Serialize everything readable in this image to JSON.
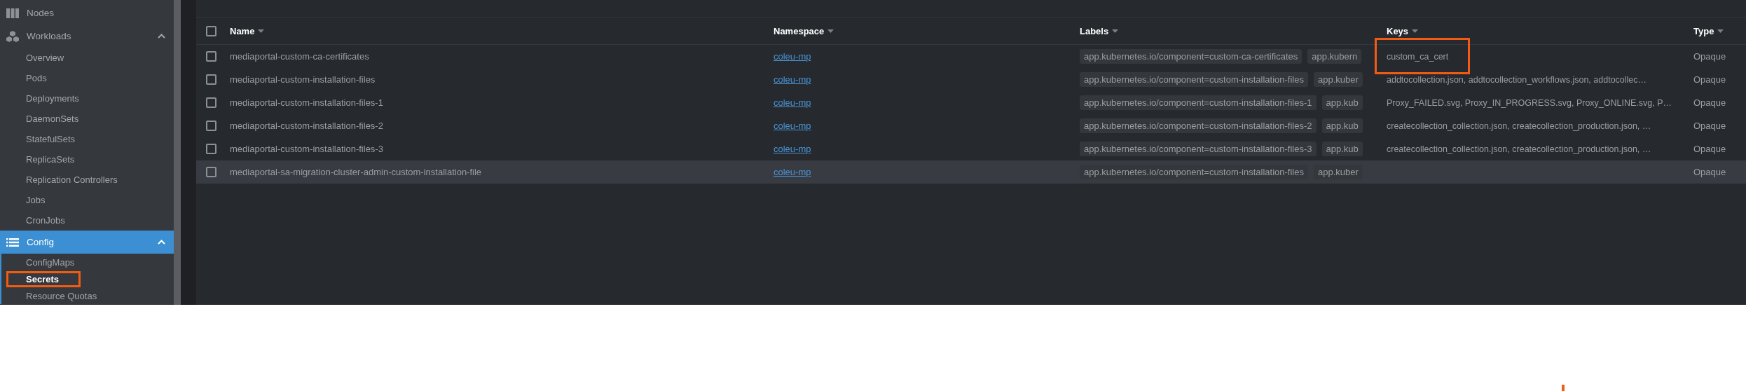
{
  "sidebar": {
    "items": [
      {
        "label": "Nodes",
        "selected": false
      },
      {
        "label": "Workloads",
        "selected": false,
        "expanded": true,
        "children": [
          {
            "label": "Overview",
            "selected": false,
            "annotated": false
          },
          {
            "label": "Pods",
            "selected": false,
            "annotated": false
          },
          {
            "label": "Deployments",
            "selected": false,
            "annotated": false
          },
          {
            "label": "DaemonSets",
            "selected": false,
            "annotated": false
          },
          {
            "label": "StatefulSets",
            "selected": false,
            "annotated": false
          },
          {
            "label": "ReplicaSets",
            "selected": false,
            "annotated": false
          },
          {
            "label": "Replication Controllers",
            "selected": false,
            "annotated": false
          },
          {
            "label": "Jobs",
            "selected": false,
            "annotated": false
          },
          {
            "label": "CronJobs",
            "selected": false,
            "annotated": false
          }
        ]
      },
      {
        "label": "Config",
        "selected": true,
        "expanded": true,
        "children": [
          {
            "label": "ConfigMaps",
            "selected": false,
            "annotated": false
          },
          {
            "label": "Secrets",
            "selected": true,
            "annotated": true
          },
          {
            "label": "Resource Quotas",
            "selected": false,
            "annotated": false
          }
        ]
      }
    ]
  },
  "table": {
    "select_all": {
      "checked": false
    },
    "columns": [
      {
        "label": "Name"
      },
      {
        "label": "Namespace"
      },
      {
        "label": "Labels"
      },
      {
        "label": "Keys"
      },
      {
        "label": "Type"
      }
    ],
    "rows": [
      {
        "checked": false,
        "highlighted": false,
        "annotated": true,
        "name": "mediaportal-custom-ca-certificates",
        "namespace": "coleu-mp",
        "labels": [
          "app.kubernetes.io/component=custom-ca-certificates",
          "app.kubern"
        ],
        "keys": "custom_ca_cert",
        "type": "Opaque"
      },
      {
        "checked": false,
        "highlighted": false,
        "annotated": false,
        "name": "mediaportal-custom-installation-files",
        "namespace": "coleu-mp",
        "labels": [
          "app.kubernetes.io/component=custom-installation-files",
          "app.kuber"
        ],
        "keys": "addtocollection.json, addtocollection_workflows.json, addtocollec…",
        "type": "Opaque"
      },
      {
        "checked": false,
        "highlighted": false,
        "annotated": false,
        "name": "mediaportal-custom-installation-files-1",
        "namespace": "coleu-mp",
        "labels": [
          "app.kubernetes.io/component=custom-installation-files-1",
          "app.kub"
        ],
        "keys": "Proxy_FAILED.svg, Proxy_IN_PROGRESS.svg, Proxy_ONLINE.svg, P…",
        "type": "Opaque"
      },
      {
        "checked": false,
        "highlighted": false,
        "annotated": false,
        "name": "mediaportal-custom-installation-files-2",
        "namespace": "coleu-mp",
        "labels": [
          "app.kubernetes.io/component=custom-installation-files-2",
          "app.kub"
        ],
        "keys": "createcollection_collection.json, createcollection_production.json, …",
        "type": "Opaque"
      },
      {
        "checked": false,
        "highlighted": false,
        "annotated": false,
        "name": "mediaportal-custom-installation-files-3",
        "namespace": "coleu-mp",
        "labels": [
          "app.kubernetes.io/component=custom-installation-files-3",
          "app.kub"
        ],
        "keys": "createcollection_collection.json, createcollection_production.json, …",
        "type": "Opaque"
      },
      {
        "checked": false,
        "highlighted": true,
        "annotated": false,
        "name": "mediaportal-sa-migration-cluster-admin-custom-installation-file",
        "namespace": "coleu-mp",
        "labels": [
          "app.kubernetes.io/component=custom-installation-files",
          "app.kuber"
        ],
        "type": "Opaque"
      }
    ]
  }
}
